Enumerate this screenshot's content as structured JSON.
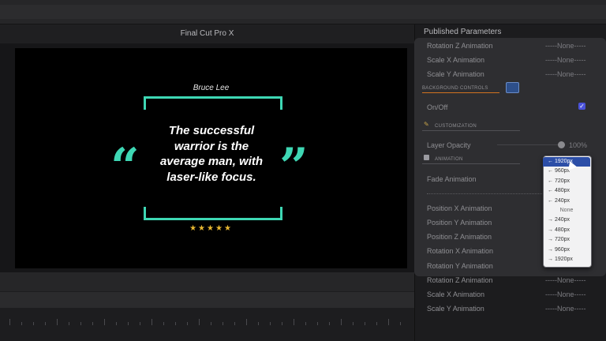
{
  "viewer": {
    "title": "Final Cut Pro X",
    "author": "Bruce Lee",
    "quote_lines": [
      "The successful",
      "warrior is the",
      "average man, with",
      "laser-like focus."
    ],
    "open_quote": "“",
    "close_quote": "”",
    "stars": "★★★★★"
  },
  "inspector": {
    "title": "Published Parameters",
    "rows_top": [
      {
        "label": "Rotation Z Animation",
        "value": "-----None-----"
      },
      {
        "label": "Scale X Animation",
        "value": "-----None-----"
      },
      {
        "label": "Scale Y Animation",
        "value": "-----None-----"
      }
    ],
    "background_controls": "BACKGROUND CONTROLS",
    "on_off": "On/Off",
    "customization": "CUSTOMIZATION",
    "layer_opacity": "Layer Opacity",
    "layer_opacity_value": "100%",
    "animation": "ANIMATION",
    "fade_animation": "Fade Animation",
    "rows_bottom": [
      {
        "label": "Position X Animation",
        "value": ""
      },
      {
        "label": "Position Y Animation",
        "value": ""
      },
      {
        "label": "Position Z Animation",
        "value": ""
      },
      {
        "label": "Rotation X Animation",
        "value": ""
      },
      {
        "label": "Rotation Y Animation",
        "value": ""
      },
      {
        "label": "Rotation Z Animation",
        "value": "-----None-----"
      },
      {
        "label": "Scale X Animation",
        "value": "-----None-----"
      },
      {
        "label": "Scale Y Animation",
        "value": "-----None-----"
      }
    ]
  },
  "dropdown": {
    "items": [
      "← 1920px",
      "← 960px",
      "← 720px",
      "← 480px",
      "← 240px",
      "None",
      "→ 240px",
      "→ 480px",
      "→ 720px",
      "→ 960px",
      "→ 1920px"
    ],
    "selected_index": 0
  },
  "colors": {
    "accent_teal": "#3ed7b4",
    "star_gold": "#e8b932",
    "checkbox_blue": "#4a52d9",
    "selected_blue": "#2c4ea7"
  }
}
